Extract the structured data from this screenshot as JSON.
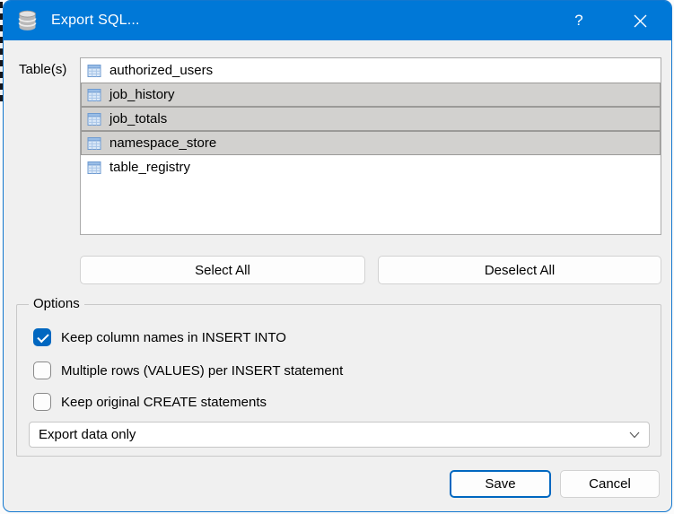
{
  "window": {
    "title": "Export SQL...",
    "help_label": "?"
  },
  "table_section": {
    "label": "Table(s)",
    "items": [
      {
        "name": "authorized_users",
        "selected": false
      },
      {
        "name": "job_history",
        "selected": true
      },
      {
        "name": "job_totals",
        "selected": true
      },
      {
        "name": "namespace_store",
        "selected": true
      },
      {
        "name": "table_registry",
        "selected": false
      }
    ],
    "select_all_label": "Select All",
    "deselect_all_label": "Deselect All"
  },
  "options": {
    "label": "Options",
    "checkboxes": [
      {
        "label": "Keep column names in INSERT INTO",
        "checked": true
      },
      {
        "label": "Multiple rows (VALUES) per INSERT statement",
        "checked": false
      },
      {
        "label": "Keep original CREATE statements",
        "checked": false
      }
    ],
    "dropdown": {
      "value": "Export data only"
    }
  },
  "footer": {
    "save_label": "Save",
    "cancel_label": "Cancel"
  },
  "colors": {
    "titlebar": "#0078d7",
    "accent": "#0067c0",
    "dialog_bg": "#f0f0f0",
    "selected_row_bg": "#d2d1cf"
  }
}
